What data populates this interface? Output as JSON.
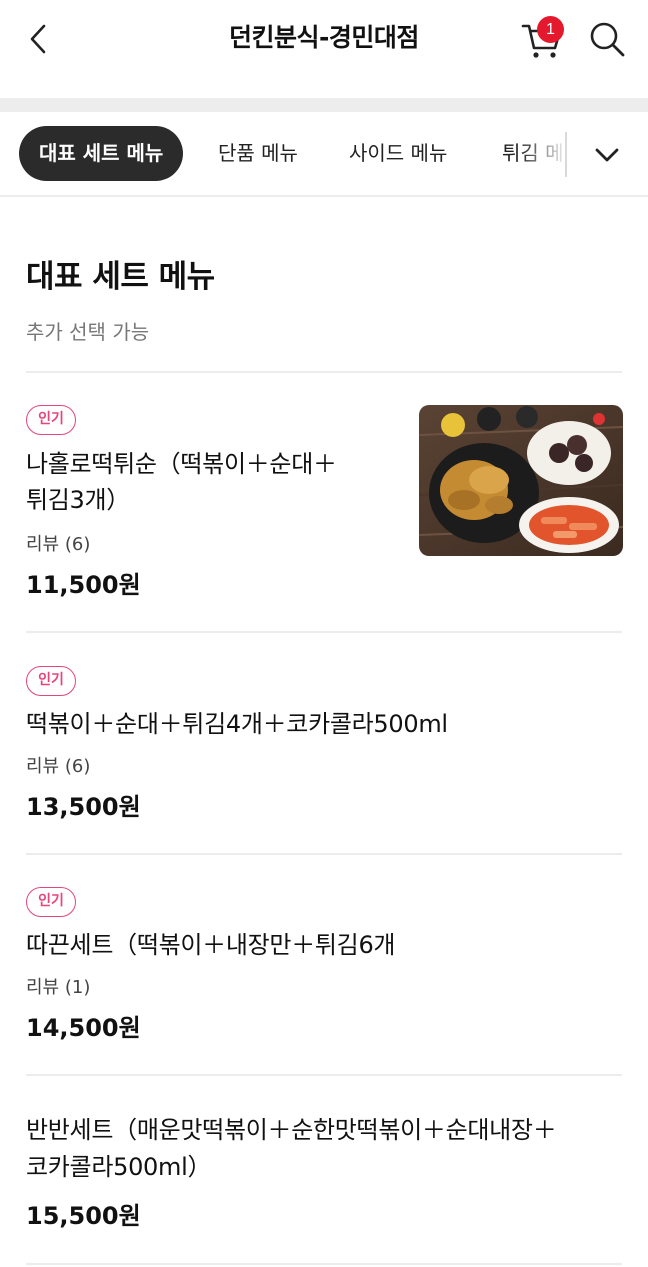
{
  "header": {
    "title": "던킨분식-경민대점",
    "cart_count": "1",
    "icons": [
      "back-arrow-icon",
      "cart-icon",
      "search-icon"
    ]
  },
  "tabs": {
    "items": [
      {
        "label": "대표 세트 메뉴",
        "active": true
      },
      {
        "label": "단품 메뉴",
        "active": false
      },
      {
        "label": "사이드 메뉴",
        "active": false
      },
      {
        "label": "튀김 메",
        "active": false
      }
    ]
  },
  "section": {
    "title": "대표 세트 메뉴",
    "subtitle": "추가 선택 가능"
  },
  "items": [
    {
      "badge": "인기",
      "name_line1": "나홀로떡튀순（떡볶이＋순대＋",
      "name_line2": "튀김3개）",
      "review": "리뷰 (6)",
      "price": "11,500원"
    },
    {
      "badge": "인기",
      "name_line1": "떡볶이＋순대＋튀김4개＋코카콜라500ml",
      "review": "리뷰 (6)",
      "price": "13,500원"
    },
    {
      "badge": "인기",
      "name_line1": "따끈세트（떡볶이＋내장만＋튀김6개",
      "review": "리뷰 (1)",
      "price": "14,500원"
    },
    {
      "name_line1": "반반세트（매운맛떡볶이＋순한맛떡볶이＋순대내장＋",
      "name_line2": "코카콜라500ml）",
      "price": "15,500원"
    }
  ],
  "colors": {
    "accent_badge": "#e5467a",
    "cart_badge": "#e5192d",
    "active_tab_bg": "#2b2b2b"
  }
}
